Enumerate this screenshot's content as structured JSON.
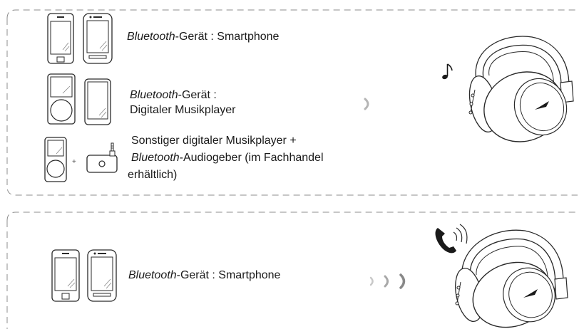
{
  "music_panel": {
    "smartphone": {
      "brand": "Bluetooth",
      "rest": "-Gerät : Smartphone"
    },
    "music_player": {
      "brand": "Bluetooth",
      "rest": "-Gerät :",
      "line2": "Digitaler Musikplayer"
    },
    "other_player": {
      "line1": "Sonstiger digitaler Musikplayer +",
      "brand": "Bluetooth",
      "rest": "-Audiogeber (im Fachhandel",
      "line3": "erhältlich)"
    },
    "plus_sign": "+"
  },
  "call_panel": {
    "smartphone": {
      "brand": "Bluetooth",
      "rest": "-Gerät : Smartphone"
    }
  },
  "icons": [
    "smartphone-icon",
    "phone-icon",
    "music-player-icon",
    "audio-transmitter-icon",
    "headphones-icon",
    "music-note-icon",
    "phone-call-icon",
    "signal-arrow-icon"
  ],
  "colors": {
    "line": "#2a2a2a",
    "frame": "#8c8c8c"
  }
}
